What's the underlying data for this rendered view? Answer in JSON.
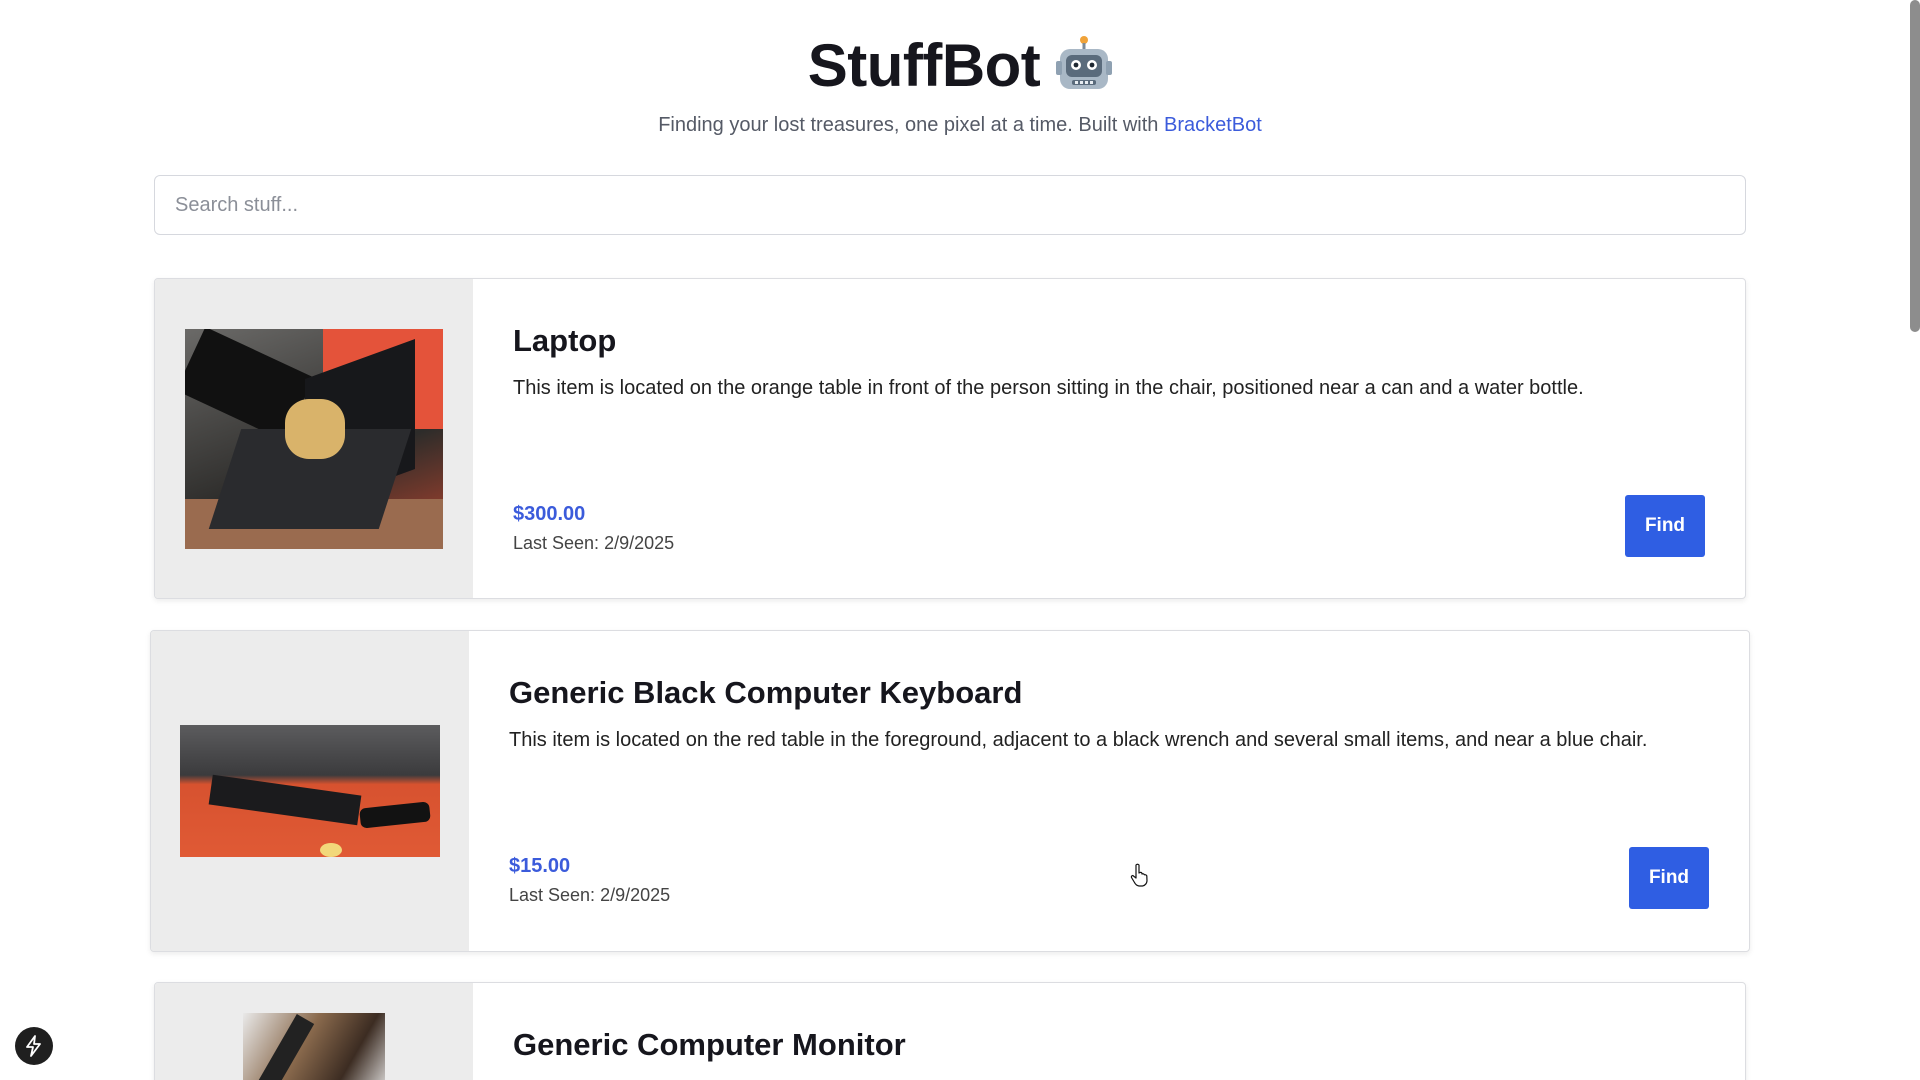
{
  "header": {
    "title": "StuffBot",
    "icon": "robot-emoji-icon",
    "subtitle": "Finding your lost treasures, one pixel at a time. Built with",
    "link_label": "BracketBot"
  },
  "search": {
    "placeholder": "Search stuff...",
    "value": ""
  },
  "items": [
    {
      "name": "Laptop",
      "description": "This item is located on the orange table in front of the person sitting in the chair, positioned near a can and a water bottle.",
      "price": "$300.00",
      "last_seen": "Last Seen: 2/9/2025",
      "button": "Find",
      "image": "laptop-photo"
    },
    {
      "name": "Generic Black Computer Keyboard",
      "description": "This item is located on the red table in the foreground, adjacent to a black wrench and several small items, and near a blue chair.",
      "price": "$15.00",
      "last_seen": "Last Seen: 2/9/2025",
      "button": "Find",
      "image": "keyboard-photo"
    },
    {
      "name": "Generic Computer Monitor",
      "image": "monitor-photo"
    }
  ],
  "colors": {
    "accent": "#3b5bdb",
    "button": "#2f5ee3",
    "image_panel": "#ececec"
  },
  "icons": {
    "fab": "lightning-bolt-icon",
    "cursor": "hand-pointer-icon"
  }
}
